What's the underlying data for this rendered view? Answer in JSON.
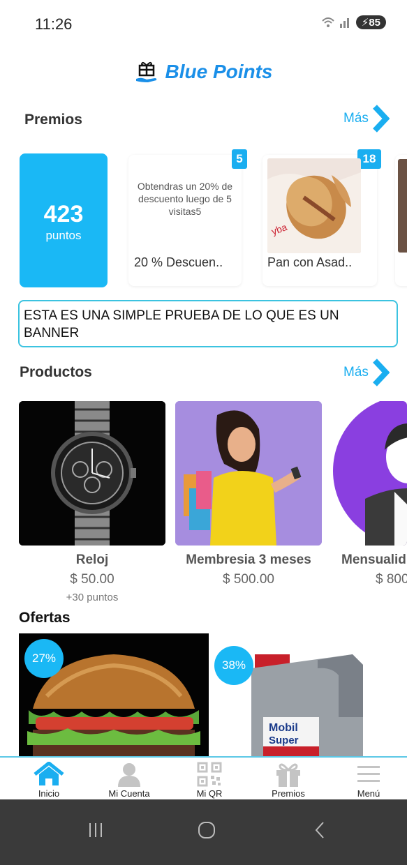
{
  "status": {
    "time": "11:26",
    "battery": "85"
  },
  "header": {
    "title": "Blue Points"
  },
  "prizes": {
    "title": "Premios",
    "more_label": "Más",
    "points_value": "423",
    "points_label": "puntos",
    "items": [
      {
        "badge": "5",
        "description": "Obtendras un 20% de descuento luego de 5 visitas5",
        "name": "20 % Descuen.."
      },
      {
        "badge": "18",
        "name": "Pan con Asad.."
      }
    ]
  },
  "banner": {
    "text": "ESTA ES UNA SIMPLE PRUEBA DE LO QUE ES UN BANNER"
  },
  "products": {
    "title": "Productos",
    "more_label": "Más",
    "items": [
      {
        "name": "Reloj",
        "price": "$ 50.00",
        "extra": "+30 puntos"
      },
      {
        "name": "Membresia 3 meses",
        "price": "$ 500.00"
      },
      {
        "name": "Mensualid",
        "price": "$ 800"
      }
    ]
  },
  "offers": {
    "title": "Ofertas",
    "items": [
      {
        "discount": "27%"
      },
      {
        "discount": "38%",
        "product_text": "Mobil Super"
      }
    ]
  },
  "bottom_nav": {
    "items": [
      {
        "label": "Inicio",
        "icon": "home-icon",
        "active": true
      },
      {
        "label": "Mi Cuenta",
        "icon": "user-icon"
      },
      {
        "label": "Mi QR",
        "icon": "qr-icon"
      },
      {
        "label": "Premios",
        "icon": "gift-icon"
      },
      {
        "label": "Menú",
        "icon": "menu-icon"
      }
    ]
  },
  "colors": {
    "accent": "#1ab8f5",
    "brand": "#1a8fe8",
    "banner_border": "#3cc3e0"
  }
}
